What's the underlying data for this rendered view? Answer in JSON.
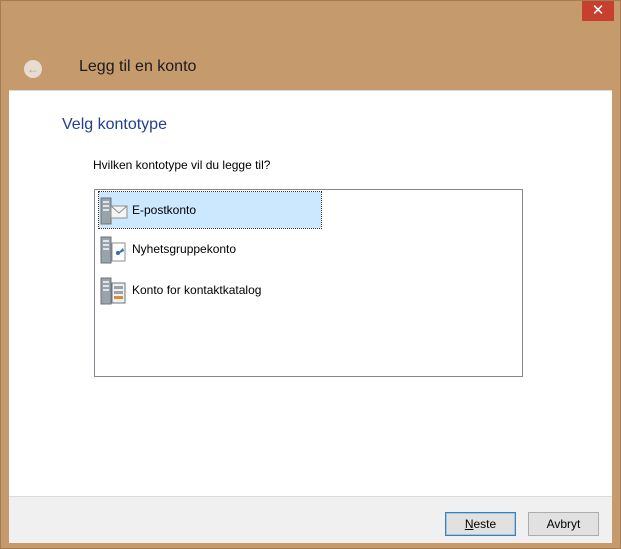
{
  "window": {
    "close_label": "✕"
  },
  "header": {
    "title": "Legg til en konto",
    "back_glyph": "←"
  },
  "main": {
    "heading": "Velg kontotype",
    "question": "Hvilken kontotype vil du legge til?",
    "account_types": [
      {
        "label": "E-postkonto",
        "icon": "email-account-icon",
        "selected": true
      },
      {
        "label": "Nyhetsgruppekonto",
        "icon": "newsgroup-account-icon",
        "selected": false
      },
      {
        "label": "Konto for kontaktkatalog",
        "icon": "directory-account-icon",
        "selected": false
      }
    ]
  },
  "footer": {
    "next_label_first": "N",
    "next_label_rest": "este",
    "cancel_label": "Avbryt"
  },
  "colors": {
    "titlebar": "#c59a6d",
    "close": "#c7402f",
    "heading": "#1f3f8f",
    "selection": "#cce8ff"
  }
}
